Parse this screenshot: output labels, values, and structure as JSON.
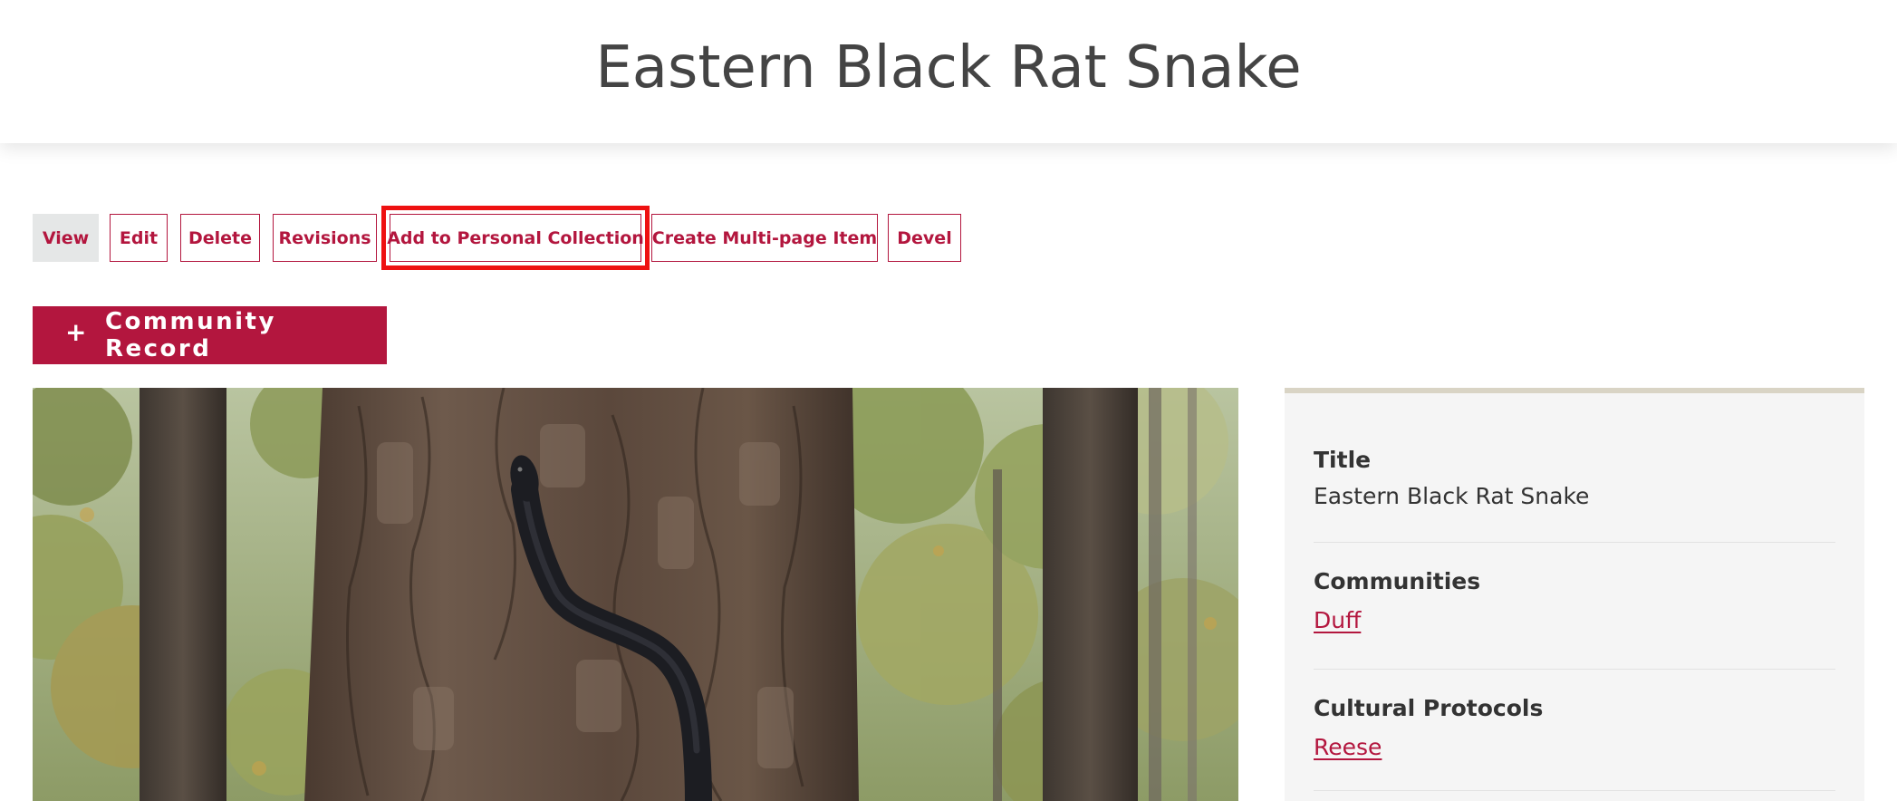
{
  "page": {
    "title": "Eastern Black Rat Snake"
  },
  "tabs": [
    {
      "label": "View",
      "active": true
    },
    {
      "label": "Edit",
      "active": false
    },
    {
      "label": "Delete",
      "active": false
    },
    {
      "label": "Revisions",
      "active": false
    },
    {
      "label": "Add to Personal Collection",
      "active": false,
      "highlighted": true
    },
    {
      "label": "Create Multi-page Item",
      "active": false
    },
    {
      "label": "Devel",
      "active": false
    }
  ],
  "community_record": {
    "icon": "plus-icon",
    "plus": "+",
    "label": "Community Record"
  },
  "media": {
    "description_icon": "photo-of-snake-on-tree"
  },
  "sidebar": {
    "fields": [
      {
        "label": "Title",
        "value": "Eastern Black Rat Snake"
      },
      {
        "label": "Communities",
        "link": "Duff"
      },
      {
        "label": "Cultural Protocols",
        "link": "Reese"
      }
    ]
  },
  "colors": {
    "brand": "#b3163e",
    "highlight": "#ee1111",
    "sidebar_bg": "#f5f5f5",
    "sidebar_border": "#d9d4c5",
    "active_tab_bg": "#e5e7e7"
  }
}
